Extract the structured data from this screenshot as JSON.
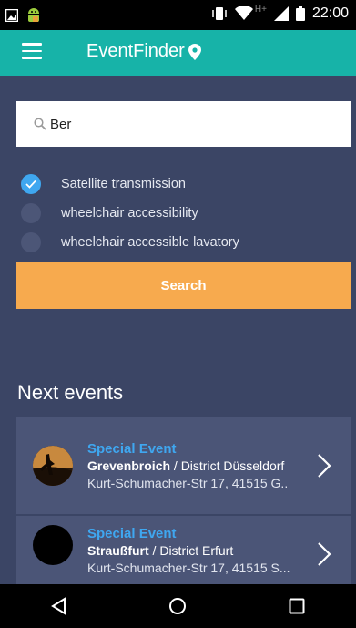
{
  "status": {
    "time": "22:00",
    "network": "H+"
  },
  "app": {
    "title": "EventFinder"
  },
  "search": {
    "value": "Ber",
    "button_label": "Search"
  },
  "filters": [
    {
      "label": "Satellite transmission",
      "checked": true
    },
    {
      "label": "wheelchair accessibility",
      "checked": false
    },
    {
      "label": "wheelchair accessible lavatory",
      "checked": false
    }
  ],
  "events": {
    "title": "Next events",
    "items": [
      {
        "type": "Special Event",
        "city": "Grevenbroich",
        "district": " / District Düsseldorf",
        "address": "Kurt-Schumacher-Str 17, 41515 G.."
      },
      {
        "type": "Special Event",
        "city": "Straußfurt",
        "district": " / District Erfurt",
        "address": "Kurt-Schumacher-Str 17, 41515 S..."
      }
    ]
  },
  "colors": {
    "accent": "#17b3a8",
    "background": "#3b4565",
    "button": "#f7aa4e",
    "link": "#3fa7f0"
  }
}
